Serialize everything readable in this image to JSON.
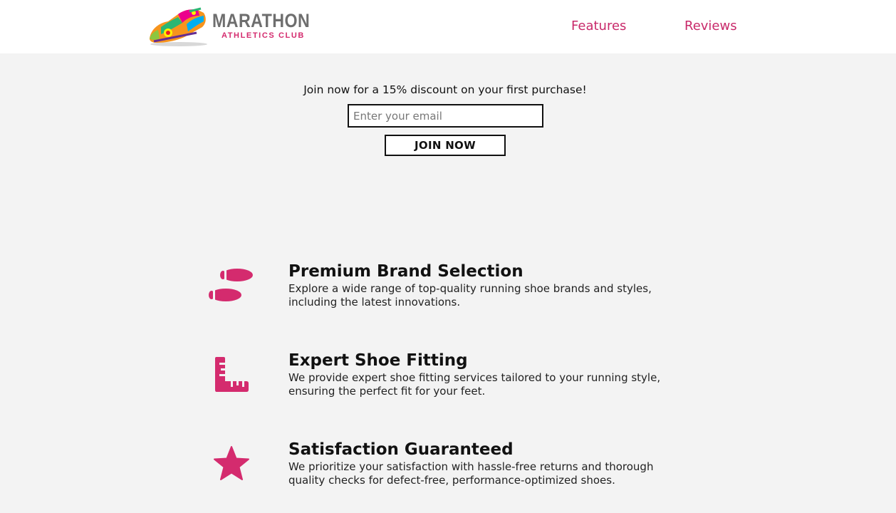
{
  "header": {
    "logo": {
      "word": "MARATHON",
      "sub": "ATHLETICS CLUB"
    },
    "nav": [
      {
        "label": "Features"
      },
      {
        "label": "Reviews"
      }
    ]
  },
  "signup": {
    "text": "Join now for a 15% discount on your first purchase!",
    "email_placeholder": "Enter your email",
    "button_label": "JOIN NOW"
  },
  "features": [
    {
      "icon": "footprints-icon",
      "title": "Premium Brand Selection",
      "description": "Explore a wide range of top-quality running shoe brands and styles, including the latest innovations."
    },
    {
      "icon": "ruler-icon",
      "title": "Expert Shoe Fitting",
      "description": "We provide expert shoe fitting services tailored to your running style, ensuring the perfect fit for your feet."
    },
    {
      "icon": "star-icon",
      "title": "Satisfaction Guaranteed",
      "description": "We prioritize your satisfaction with hassle-free returns and thorough quality checks for defect-free, performance-optimized shoes."
    }
  ],
  "colors": {
    "accent": "#c8296a",
    "background": "#f3f3f3",
    "header_bg": "#ffffff"
  }
}
